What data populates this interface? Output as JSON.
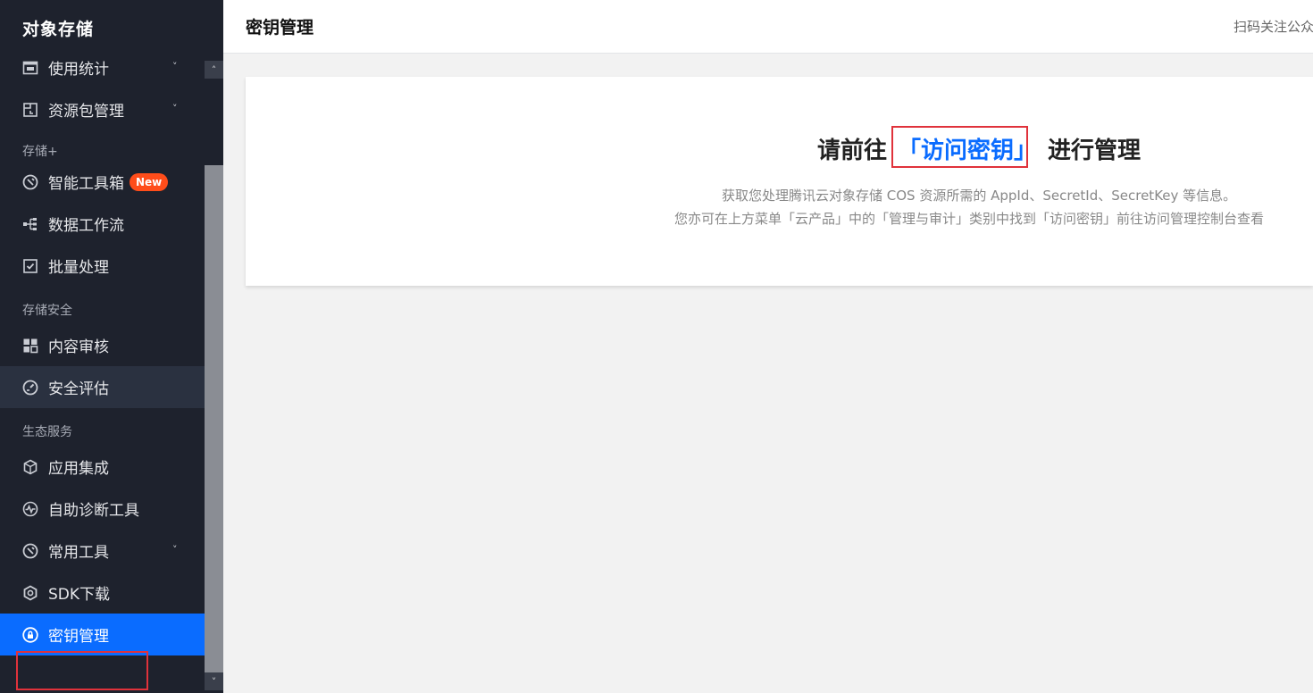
{
  "sidebar": {
    "brand": "对象存储",
    "items_top": [
      {
        "label": "使用统计",
        "icon": "calendar-icon",
        "has_chevron": true
      },
      {
        "label": "资源包管理",
        "icon": "package-icon",
        "has_chevron": true
      }
    ],
    "group_storage_plus": "存储+",
    "items_storage_plus": [
      {
        "label": "智能工具箱",
        "icon": "toolbox-icon",
        "badge": "New"
      },
      {
        "label": "数据工作流",
        "icon": "workflow-icon"
      },
      {
        "label": "批量处理",
        "icon": "checkbox-icon"
      }
    ],
    "group_security": "存储安全",
    "items_security": [
      {
        "label": "内容审核",
        "icon": "grid-icon"
      },
      {
        "label": "安全评估",
        "icon": "gauge-icon"
      }
    ],
    "group_ecosystem": "生态服务",
    "items_ecosystem": [
      {
        "label": "应用集成",
        "icon": "cube-icon"
      },
      {
        "label": "自助诊断工具",
        "icon": "pulse-icon"
      },
      {
        "label": "常用工具",
        "icon": "tool-icon",
        "has_chevron": true
      },
      {
        "label": "SDK下载",
        "icon": "hexagon-icon"
      },
      {
        "label": "密钥管理",
        "icon": "key-icon"
      }
    ],
    "chevron": "˅",
    "scroll_up": "˄",
    "scroll_down": "˅"
  },
  "header": {
    "title": "密钥管理",
    "right_text": "扫码关注公众"
  },
  "main": {
    "prompt_before": "请前往",
    "prompt_link": "「访问密钥」",
    "prompt_after": "进行管理",
    "desc_line1": "获取您处理腾讯云对象存储 COS 资源所需的 AppId、SecretId、SecretKey 等信息。",
    "desc_line2": "您亦可在上方菜单「云产品」中的「管理与审计」类别中找到「访问密钥」前往访问管理控制台查看"
  },
  "colors": {
    "sidebar_bg": "#1e222d",
    "active_bg": "#0a6cff",
    "link": "#0a6cff",
    "badge": "#ff4d1a",
    "highlight_outline": "#e0323b"
  }
}
